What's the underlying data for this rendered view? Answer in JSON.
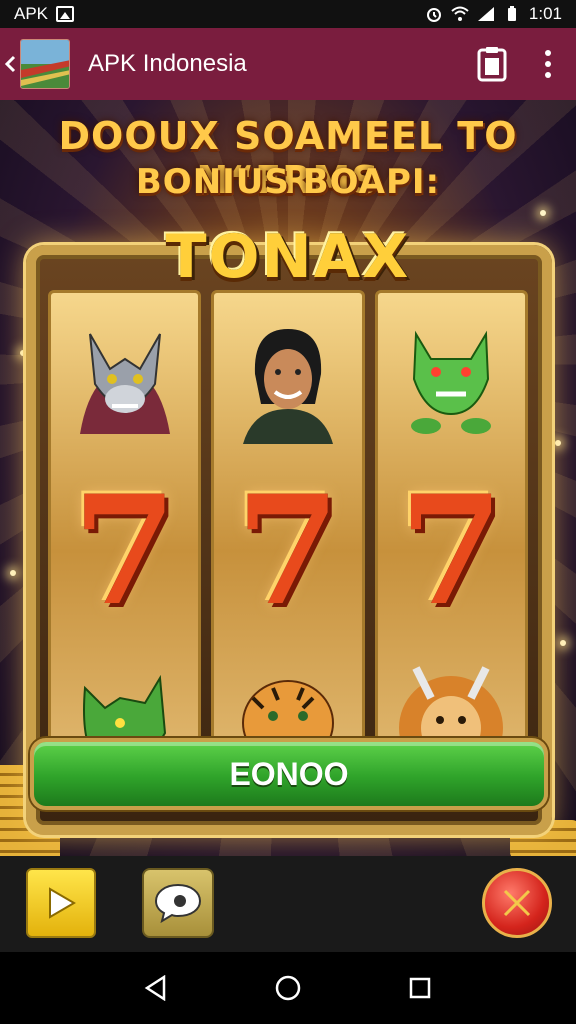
{
  "status_bar": {
    "app_label": "APK",
    "time": "1:01",
    "icons": [
      "image-icon",
      "alarm-icon",
      "wifi-icon",
      "signal-icon",
      "battery-icon"
    ]
  },
  "app_bar": {
    "title": "APK Indonesia",
    "icons": [
      "back-icon",
      "app-logo",
      "clipboard-icon",
      "more-icon"
    ],
    "background": "#7a1d3e"
  },
  "game": {
    "headline_1": "DOOUX SOAMEEL TO N“ERMS",
    "headline_2": "BONIUS BOAPI:",
    "logo": "TONAX",
    "reels": [
      {
        "top": "wolf-icon",
        "middle": "7",
        "bottom": "green-beast-icon"
      },
      {
        "top": "man-portrait-icon",
        "middle": "7",
        "bottom": "tiger-icon"
      },
      {
        "top": "green-creature-icon",
        "middle": "7",
        "bottom": "lion-icon"
      }
    ],
    "spin_label": "EONOO",
    "colors": {
      "gold": "#c9a04a",
      "green": "#2fa32a",
      "seven": "#e84a1c"
    }
  },
  "controls": {
    "icons": [
      "play-icon",
      "chat-icon",
      "close-icon"
    ]
  },
  "nav_bar": {
    "icons": [
      "nav-back-icon",
      "nav-home-icon",
      "nav-recents-icon"
    ]
  }
}
